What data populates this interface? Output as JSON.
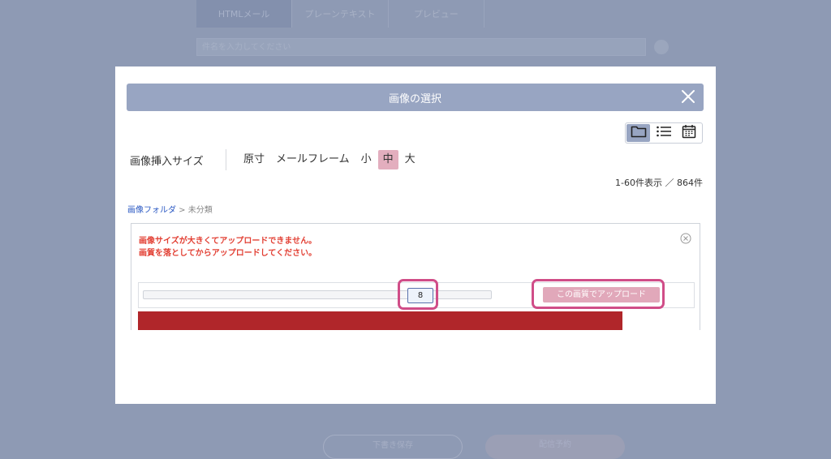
{
  "background": {
    "tabs": [
      "HTMLメール",
      "プレーンテキスト",
      "プレビュー"
    ],
    "subject_placeholder": "件名を入力してください",
    "footer_buttons": [
      "下書き保存",
      "配信予約"
    ]
  },
  "modal": {
    "title": "画像の選択",
    "view_modes": [
      {
        "icon": "folder-icon",
        "active": true
      },
      {
        "icon": "list-icon",
        "active": false
      },
      {
        "icon": "calendar-icon",
        "active": false
      }
    ],
    "size": {
      "label": "画像挿入サイズ",
      "options": [
        "原寸",
        "メールフレーム",
        "小",
        "中",
        "大"
      ],
      "selected": "中"
    },
    "count_text": "1-60件表示 ／ 864件",
    "breadcrumb": {
      "root": "画像フォルダ",
      "separator": " > ",
      "current": "未分類"
    },
    "error": {
      "line1": "画像サイズが大きくてアップロードできません。",
      "line2": "画質を落としてからアップロードしてください。"
    },
    "quality_value": "8",
    "upload_button": "この画質でアップロード"
  },
  "colors": {
    "header": "#98a5c2",
    "highlight": "#d04d88",
    "upload_button": "#e1a8ba",
    "error_text": "#e23f33",
    "progress_bar": "#b0262a"
  }
}
